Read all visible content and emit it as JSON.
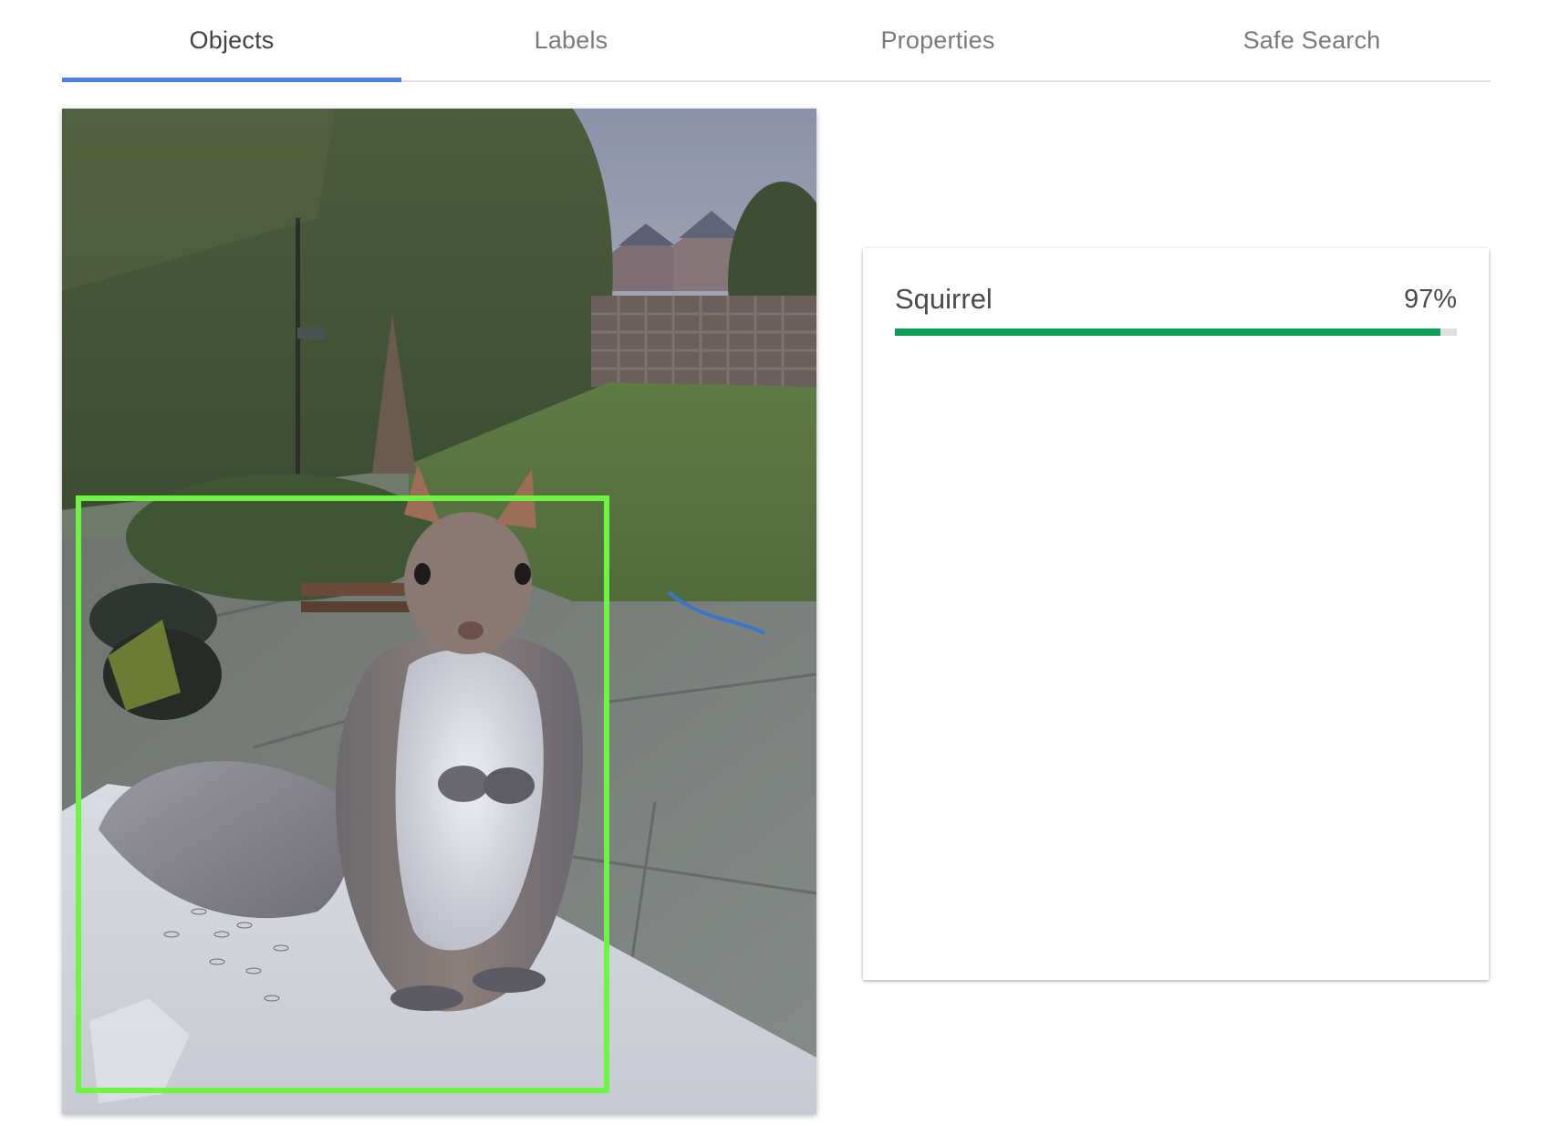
{
  "tabs": [
    {
      "label": "Objects",
      "active": true
    },
    {
      "label": "Labels",
      "active": false
    },
    {
      "label": "Properties",
      "active": false
    },
    {
      "label": "Safe Search",
      "active": false
    }
  ],
  "colors": {
    "tab_indicator": "#4e7ee6",
    "bounding_box": "#6ef442",
    "score_bar": "#0f9d58",
    "score_track": "#e0e0e0"
  },
  "results": [
    {
      "label": "Squirrel",
      "score_text": "97%",
      "score": 0.97
    }
  ]
}
